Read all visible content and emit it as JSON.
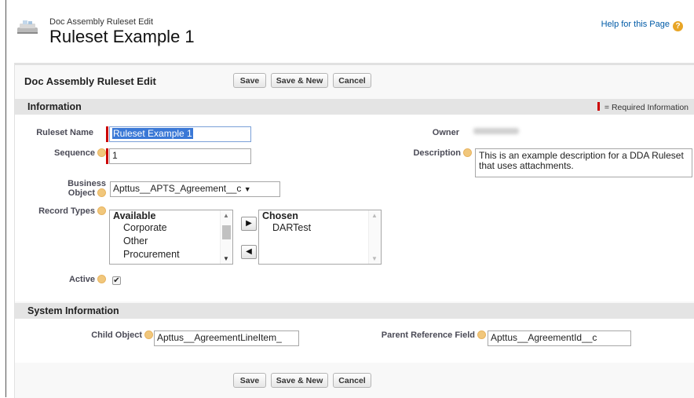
{
  "header": {
    "subtitle": "Doc Assembly Ruleset Edit",
    "title": "Ruleset Example 1",
    "help_link": "Help for this Page",
    "help_icon": "question-icon"
  },
  "page_block": {
    "title": "Doc Assembly Ruleset Edit",
    "buttons": {
      "save": "Save",
      "save_new": "Save & New",
      "cancel": "Cancel"
    }
  },
  "information": {
    "title": "Information",
    "required_legend": "= Required Information",
    "ruleset_name_label": "Ruleset Name",
    "ruleset_name_value": "Ruleset Example 1",
    "sequence_label": "Sequence",
    "sequence_value": "1",
    "business_object_label_1": "Business",
    "business_object_label_2": "Object",
    "business_object_value": "Apttus__APTS_Agreement__c",
    "record_types_label": "Record Types",
    "available_header": "Available",
    "available_items": [
      "Corporate",
      "Other",
      "Procurement"
    ],
    "chosen_header": "Chosen",
    "chosen_items": [
      "DARTest"
    ],
    "active_label": "Active",
    "active_checked": true,
    "owner_label": "Owner",
    "description_label": "Description",
    "description_value": "This is an example description for a DDA Ruleset that uses attachments."
  },
  "system_information": {
    "title": "System Information",
    "child_object_label": "Child Object",
    "child_object_value": "Apttus__AgreementLineItem_",
    "parent_ref_label": "Parent Reference Field",
    "parent_ref_value": "Apttus__AgreementId__c"
  },
  "colors": {
    "required": "#cc0000",
    "section_header": "#e4e4e4",
    "link": "#015ba7",
    "selection": "#3a78d6"
  }
}
